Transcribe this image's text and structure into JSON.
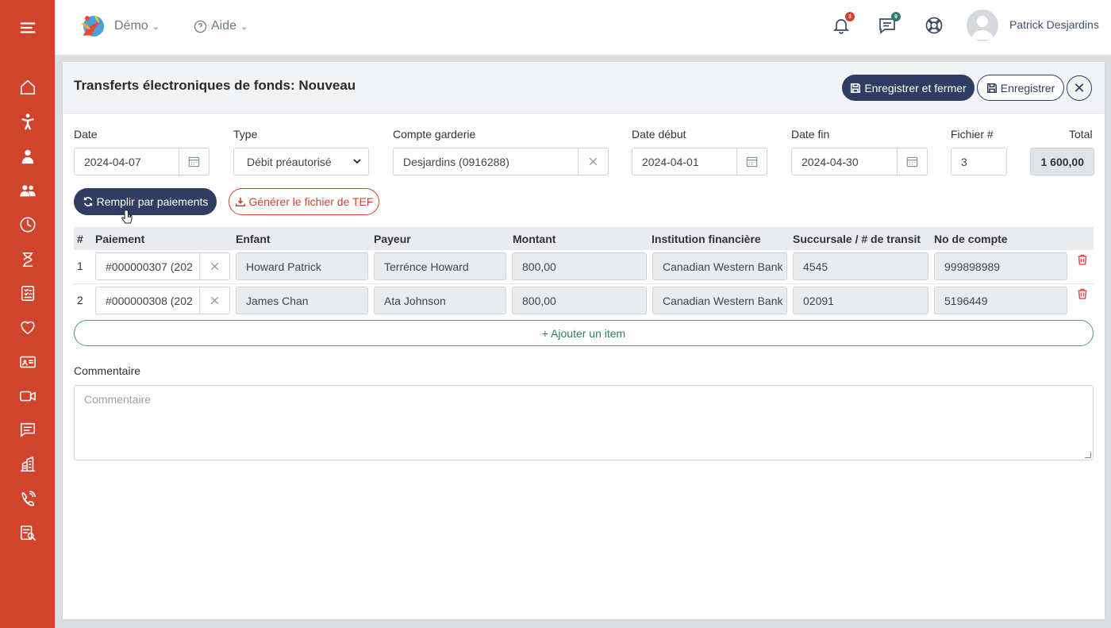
{
  "sidebar": {
    "items": [
      "hamburger-icon",
      "home-icon",
      "child-icon",
      "educator-icon",
      "group-icon",
      "clock-icon",
      "hourglass-icon",
      "checklist-icon",
      "heart-icon",
      "id-card-icon",
      "video-icon",
      "chat-icon",
      "building-icon",
      "phone-icon",
      "report-icon"
    ]
  },
  "topbar": {
    "org_menu": "Démo",
    "help_menu": "Aide",
    "notif_count": "3",
    "message_count": "9",
    "user_name": "Patrick Desjardins"
  },
  "page": {
    "title": "Transferts électroniques de fonds: Nouveau",
    "save_close_label": "Enregistrer et fermer",
    "save_label": "Enregistrer"
  },
  "form": {
    "date_label": "Date",
    "date_value": "2024-04-07",
    "type_label": "Type",
    "type_value": "Débit préautorisé",
    "account_label": "Compte garderie",
    "account_value": "Desjardins (0916288)",
    "start_label": "Date début",
    "start_value": "2024-04-01",
    "end_label": "Date fin",
    "end_value": "2024-04-30",
    "file_label": "Fichier #",
    "file_value": "3",
    "total_label": "Total",
    "total_value": "1 600,00",
    "fill_button": "Remplir par paiements",
    "generate_button": "Générer le fichier de TEF"
  },
  "table": {
    "headers": [
      "#",
      "Paiement",
      "Enfant",
      "Payeur",
      "Montant",
      "Institution financière",
      "Succursale / # de transit",
      "No de compte"
    ],
    "rows": [
      {
        "num": "1",
        "payment": "#000000307 (202",
        "child": "Howard Patrick",
        "payer": "Terrénce Howard",
        "amount": "800,00",
        "institution": "Canadian Western Bank",
        "transit": "4545",
        "account": "999898989"
      },
      {
        "num": "2",
        "payment": "#000000308 (202",
        "child": "James Chan",
        "payer": "Ata Johnson",
        "amount": "800,00",
        "institution": "Canadian Western Bank",
        "transit": "02091",
        "account": "5196449"
      }
    ],
    "add_item": "+ Ajouter un item"
  },
  "comment": {
    "label": "Commentaire",
    "placeholder": "Commentaire"
  },
  "colors": {
    "brand_red": "#d0432d",
    "navy": "#2f3d62",
    "teal": "#2f7c6e"
  }
}
